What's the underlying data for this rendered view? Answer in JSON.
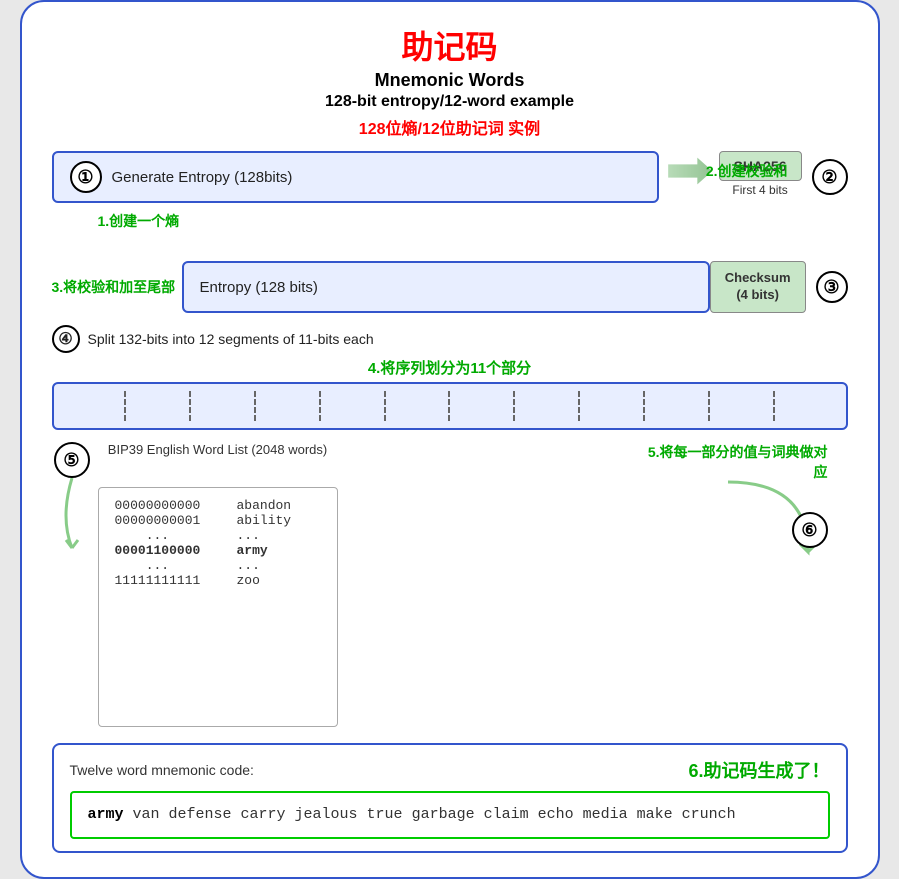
{
  "title": {
    "cn": "助记码",
    "en1": "Mnemonic Words",
    "en2": "128-bit entropy/12-word example",
    "cn2": "128位熵/12位助记词 实例"
  },
  "labels": {
    "label1": "1.创建一个熵",
    "label2": "2.创建校验和",
    "label3": "3.将校验和加至尾部",
    "label4": "4.将序列划分为11个部分",
    "label5": "5.将每一部分的值与词典做对应",
    "label6": "6.助记码生成了！"
  },
  "steps": {
    "s1_circle": "①",
    "s1_label": "Generate Entropy (128bits)",
    "s2_circle": "②",
    "s2_sha": "SHA256",
    "s2_sub": "First 4 bits",
    "s3_circle": "③",
    "s3_entropy": "Entropy (128 bits)",
    "s3_checksum": "Checksum\n(4 bits)",
    "s4_circle": "④",
    "s4_text": "Split 132-bits into 12 segments of 11-bits each",
    "s5_circle": "⑤",
    "s6_circle": "⑥"
  },
  "wordlist": {
    "title": "BIP39 English Word List (2048 words)",
    "rows": [
      {
        "binary": "00000000000",
        "word": "abandon"
      },
      {
        "binary": "00000000001",
        "word": "ability"
      },
      {
        "binary": "...",
        "word": "..."
      },
      {
        "binary": "00001100000",
        "word": "army",
        "bold": true
      },
      {
        "binary": "...",
        "word": "..."
      },
      {
        "binary": "11111111111",
        "word": "zoo"
      }
    ]
  },
  "mnemonic": {
    "label": "Twelve word mnemonic code:",
    "text": "army van defense carry jealous true garbage claim echo media make crunch",
    "bold_word": "army"
  }
}
